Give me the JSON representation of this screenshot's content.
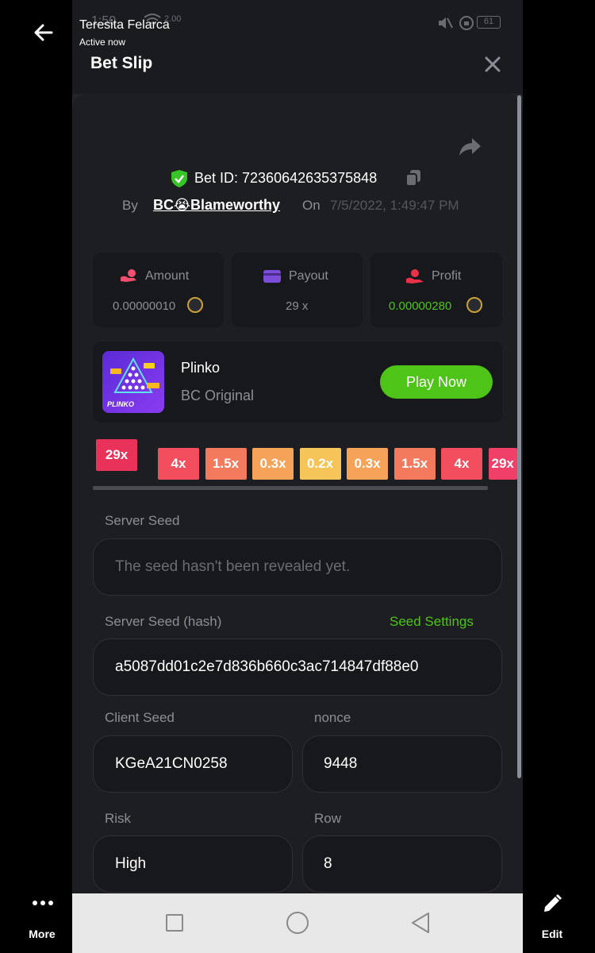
{
  "viewer": {
    "contact_name": "Teresita Felarca",
    "contact_status": "Active now",
    "more_label": "More",
    "edit_label": "Edit"
  },
  "status": {
    "time": "1:50",
    "speed": "2.00",
    "battery": "61"
  },
  "slip": {
    "title": "Bet Slip",
    "bet_id": "Bet ID: 72360642635375848",
    "by_label": "By",
    "user": "BC😭Blameworthy",
    "on_label": "On",
    "date": "7/5/2022, 1:49:47 PM"
  },
  "stats": {
    "amount_label": "Amount",
    "amount_value": "0.00000010",
    "payout_label": "Payout",
    "payout_value": "29 x",
    "profit_label": "Profit",
    "profit_value": "0.00000280"
  },
  "game": {
    "name": "Plinko",
    "subtitle": "BC Original",
    "play_label": "Play Now",
    "thumb_text": "PLINKO"
  },
  "multipliers": {
    "items": [
      "29x",
      "4x",
      "1.5x",
      "0.3x",
      "0.2x",
      "0.3x",
      "1.5x",
      "4x",
      "29x"
    ],
    "active_index": 0
  },
  "seeds": {
    "server_seed_label": "Server Seed",
    "server_seed_value": "The seed hasn't been revealed yet.",
    "hash_label": "Server Seed (hash)",
    "seed_settings": "Seed Settings",
    "hash_value": "a5087dd01c2e7d836b660c3ac714847df88e0",
    "client_seed_label": "Client Seed",
    "client_seed_value": "KGeA21CN0258",
    "nonce_label": "nonce",
    "nonce_value": "9448",
    "risk_label": "Risk",
    "risk_value": "High",
    "row_label": "Row",
    "row_value": "8"
  },
  "colors": {
    "accent_green": "#4dc417",
    "profit_green": "#4dc417",
    "background": "#1d1e21",
    "card": "#17181b"
  }
}
